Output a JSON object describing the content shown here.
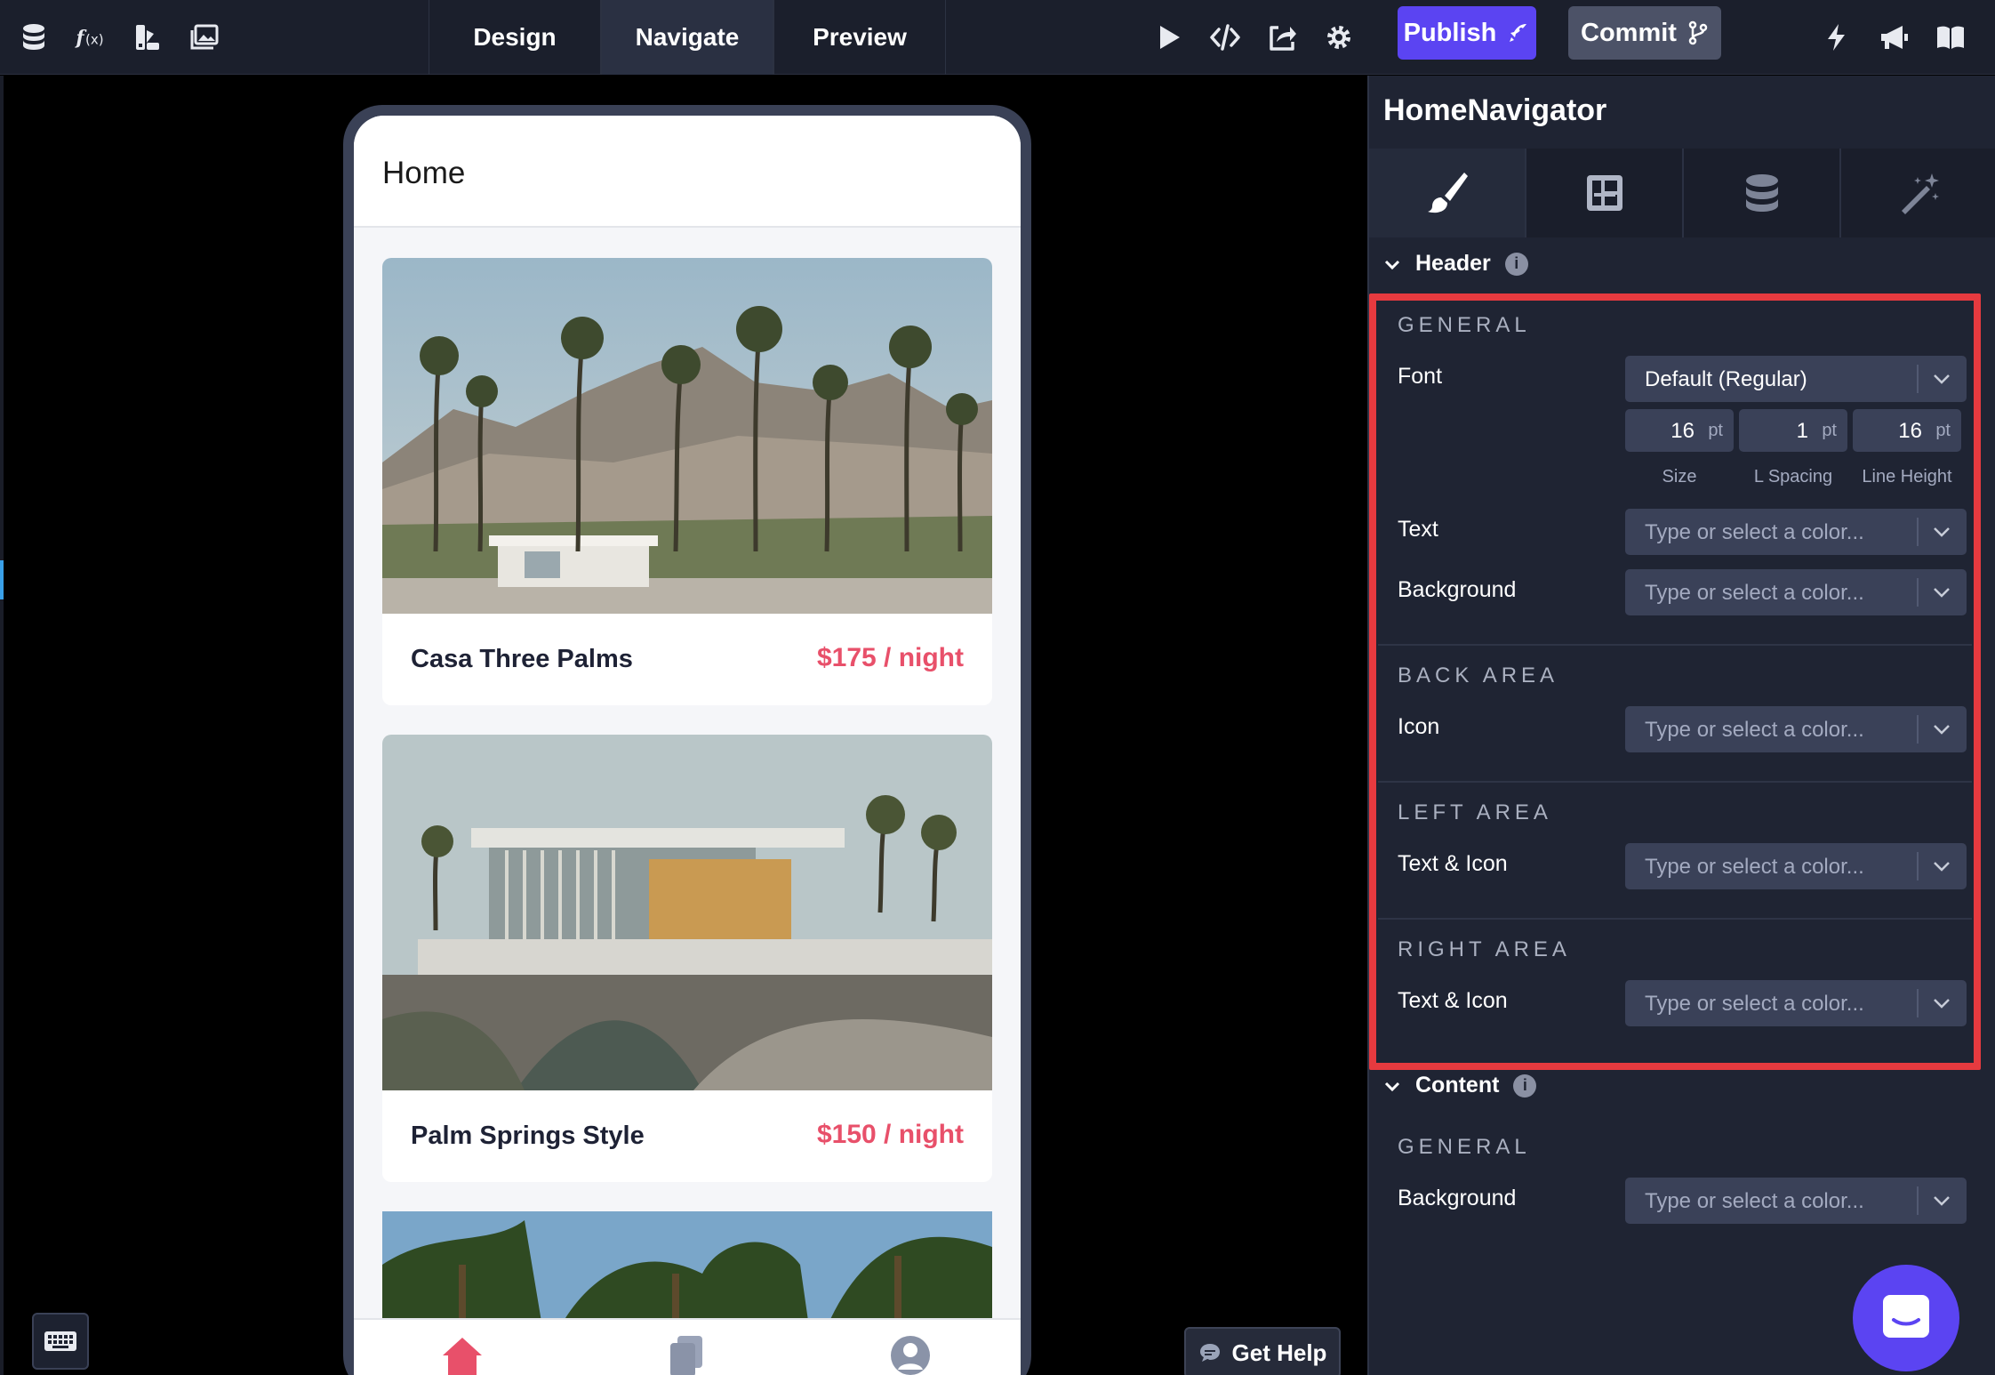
{
  "toolbar": {
    "left_icons": [
      "database-icon",
      "function-icon",
      "theme-icon",
      "image-icon"
    ],
    "modes": [
      "Design",
      "Navigate",
      "Preview"
    ],
    "active_mode": "Navigate",
    "right_icons": [
      "play-icon",
      "code-icon",
      "share-icon",
      "settings-icon"
    ],
    "publish_label": "Publish",
    "commit_label": "Commit",
    "far_right_icons": [
      "bolt-icon",
      "megaphone-icon",
      "book-icon"
    ]
  },
  "app": {
    "title": "Home",
    "listings": [
      {
        "name": "Casa Three Palms",
        "price": "$175 / night",
        "image": "palm-trees-mountains"
      },
      {
        "name": "Palm Springs Style",
        "price": "$150 / night",
        "image": "modern-house"
      },
      {
        "name": "",
        "price": "",
        "image": "palm-trees"
      }
    ],
    "tabs": [
      "home-icon",
      "bookings-icon",
      "profile-icon"
    ]
  },
  "canvas": {
    "help_label": "Get Help"
  },
  "panel": {
    "title": "HomeNavigator",
    "tabs": [
      "paint-brush-icon",
      "layout-icon",
      "database-icon",
      "magic-wand-icon"
    ],
    "header_section": "Header",
    "general_label": "GENERAL",
    "font_label": "Font",
    "font_value": "Default (Regular)",
    "size_value": "16",
    "spacing_value": "1",
    "line_height_value": "16",
    "unit": "pt",
    "size_caption": "Size",
    "spacing_caption": "L Spacing",
    "line_height_caption": "Line Height",
    "text_label": "Text",
    "background_label": "Background",
    "back_area_label": "BACK AREA",
    "icon_label": "Icon",
    "left_area_label": "LEFT AREA",
    "right_area_label": "RIGHT AREA",
    "text_icon_label": "Text & Icon",
    "color_placeholder": "Type or select a color...",
    "content_section": "Content",
    "content_general_label": "GENERAL",
    "content_background_label": "Background"
  },
  "colors": {
    "accent": "#5b44f2",
    "price": "#e8506a",
    "highlight": "#e63a3f"
  }
}
